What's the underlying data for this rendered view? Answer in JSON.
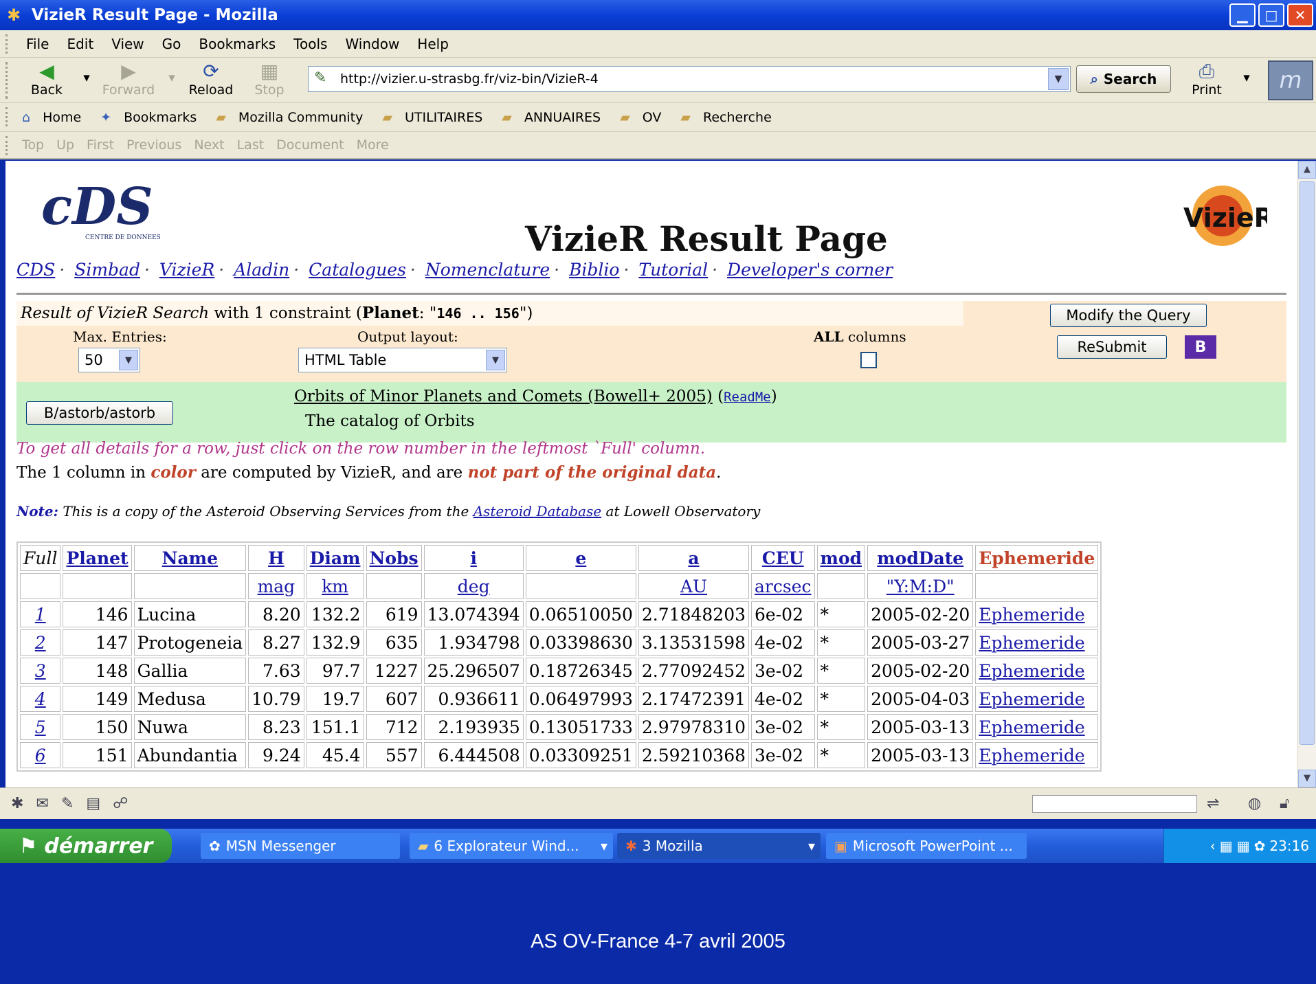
{
  "window": {
    "title": "VizieR Result Page - Mozilla"
  },
  "menu": [
    "File",
    "Edit",
    "View",
    "Go",
    "Bookmarks",
    "Tools",
    "Window",
    "Help"
  ],
  "nav": {
    "back": "Back",
    "forward": "Forward",
    "reload": "Reload",
    "stop": "Stop",
    "search": "Search",
    "print": "Print",
    "url": "http://vizier.u-strasbg.fr/viz-bin/VizieR-4"
  },
  "personal_bar": [
    "Home",
    "Bookmarks",
    "Mozilla Community",
    "UTILITAIRES",
    "ANNUAIRES",
    "OV",
    "Recherche"
  ],
  "site_nav": [
    "Top",
    "Up",
    "First",
    "Previous",
    "Next",
    "Last",
    "Document",
    "More"
  ],
  "page": {
    "title": "VizieR Result Page",
    "links": [
      "CDS",
      "Simbad",
      "VizieR",
      "Aladin",
      "Catalogues",
      "Nomenclature",
      "Biblio",
      "Tutorial",
      "Developer's corner"
    ],
    "query": {
      "result_prefix": "Result of VizieR Search",
      "result_mid": " with 1 constraint  (",
      "constraint_name": "Planet",
      "constraint_value": "146 .. 156",
      "max_entries_label": "Max. Entries:",
      "max_entries": "50",
      "output_layout_label": "Output layout:",
      "output_layout": "HTML Table",
      "all_label_bold": "ALL",
      "all_label_rest": " columns",
      "modify_button": "Modify the Query",
      "resubmit_button": "ReSubmit",
      "b_button": "B"
    },
    "catalog": {
      "id_button": "B/astorb/astorb",
      "title": "Orbits of Minor Planets and Comets (Bowell+ 2005)",
      "readme": "ReadMe",
      "subtitle": "The catalog of Orbits"
    },
    "hint1": "To get all details for a row, just click on the row number in the leftmost `Full' column.",
    "hint2_a": "The 1 column in ",
    "hint2_color": "color",
    "hint2_b": " are computed by VizieR, and are ",
    "hint2_notpart": "not part of the original data",
    "note_label": "Note:",
    "note_a": " This is a copy of the Asteroid Observing Services from the ",
    "note_link": "Asteroid Database",
    "note_b": " at Lowell Observatory"
  },
  "table": {
    "headers": [
      "Full",
      "Planet",
      "Name",
      "H",
      "Diam",
      "Nobs",
      "i",
      "e",
      "a",
      "CEU",
      "mod",
      "modDate",
      "Ephemeride"
    ],
    "units": [
      "",
      "",
      "",
      "mag",
      "km",
      "",
      "deg",
      "",
      "AU",
      "arcsec",
      "",
      "\"Y:M:D\"",
      ""
    ],
    "rows": [
      [
        "1",
        "146",
        "Lucina",
        "8.20",
        "132.2",
        "619",
        "13.074394",
        "0.06510050",
        "2.71848203",
        "6e-02",
        "*",
        "2005-02-20",
        "Ephemeride"
      ],
      [
        "2",
        "147",
        "Protogeneia",
        "8.27",
        "132.9",
        "635",
        "1.934798",
        "0.03398630",
        "3.13531598",
        "4e-02",
        "*",
        "2005-03-27",
        "Ephemeride"
      ],
      [
        "3",
        "148",
        "Gallia",
        "7.63",
        "97.7",
        "1227",
        "25.296507",
        "0.18726345",
        "2.77092452",
        "3e-02",
        "*",
        "2005-02-20",
        "Ephemeride"
      ],
      [
        "4",
        "149",
        "Medusa",
        "10.79",
        "19.7",
        "607",
        "0.936611",
        "0.06497993",
        "2.17472391",
        "4e-02",
        "*",
        "2005-04-03",
        "Ephemeride"
      ],
      [
        "5",
        "150",
        "Nuwa",
        "8.23",
        "151.1",
        "712",
        "2.193935",
        "0.13051733",
        "2.97978310",
        "3e-02",
        "*",
        "2005-03-13",
        "Ephemeride"
      ],
      [
        "6",
        "151",
        "Abundantia",
        "9.24",
        "45.4",
        "557",
        "6.444508",
        "0.03309251",
        "2.59210368",
        "3e-02",
        "*",
        "2005-03-13",
        "Ephemeride"
      ]
    ]
  },
  "taskbar": {
    "start": "démarrer",
    "tasks": [
      "MSN Messenger",
      "6 Explorateur Wind...",
      "3 Mozilla",
      "Microsoft PowerPoint ..."
    ],
    "clock": "23:16"
  },
  "caption": "AS OV-France 4-7 avril 2005"
}
